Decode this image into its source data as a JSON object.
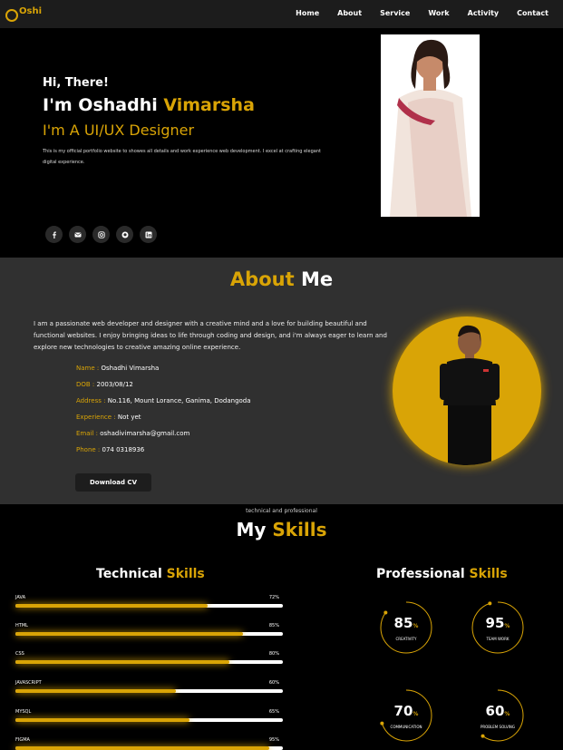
{
  "nav": {
    "logo": "Oshi",
    "items": [
      "Home",
      "About",
      "Service",
      "Work",
      "Activity",
      "Contact"
    ]
  },
  "hero": {
    "greeting": "Hi, There!",
    "name_prefix": "I'm Oshadhi",
    "name_highlight": "Vimarsha",
    "role": "I'm A UI/UX Designer",
    "description": "This is my official portfolio website to showes all details and work experience web development. I excel at crafting elegant digital experience.",
    "socials": [
      "facebook-icon",
      "mail-icon",
      "instagram-icon",
      "github-icon",
      "linkedin-icon"
    ]
  },
  "about": {
    "title_highlight": "About",
    "title_rest": "Me",
    "paragraph": "I am a passionate web developer and designer with a creative mind and a love for building beautiful and functional websites. I enjoy bringing ideas to life through coding and design, and i'm always eager to learn and explore new technologies to creative amazing online experience.",
    "info": [
      {
        "key": "Name",
        "value": "Oshadhi Vimarsha"
      },
      {
        "key": "DOB",
        "value": "2003/08/12"
      },
      {
        "key": "Address",
        "value": "No.116, Mount Lorance, Ganima, Dodangoda"
      },
      {
        "key": "Experience",
        "value": "Not yet"
      },
      {
        "key": "Email",
        "value": "oshadivimarsha@gmail.com"
      },
      {
        "key": "Phone",
        "value": "074 0318936"
      }
    ],
    "download": "Download CV"
  },
  "skills": {
    "subtitle": "technical and professional",
    "title_rest": "My",
    "title_highlight": "Skills",
    "tech_title": "Technical",
    "tech_highlight": "Skills",
    "prof_title": "Professional",
    "prof_highlight": "Skills",
    "technical": [
      {
        "name": "JAVA",
        "pct": "72%",
        "value": 72
      },
      {
        "name": "HTML",
        "pct": "85%",
        "value": 85
      },
      {
        "name": "CSS",
        "pct": "80%",
        "value": 80
      },
      {
        "name": "JAVASCRIPT",
        "pct": "60%",
        "value": 60
      },
      {
        "name": "MYSQL",
        "pct": "65%",
        "value": 65
      },
      {
        "name": "FIGMA",
        "pct": "95%",
        "value": 95
      }
    ],
    "professional": [
      {
        "value": "85",
        "label": "CREATIVITY",
        "level": 85
      },
      {
        "value": "95",
        "label": "TEAM WORK",
        "level": 95
      },
      {
        "value": "70",
        "label": "COMMUNICATION",
        "level": 70
      },
      {
        "value": "60",
        "label": "PROBLEM SOLVING",
        "level": 60
      }
    ],
    "percent_sign": "%"
  },
  "colors": {
    "accent": "#d9a406",
    "bg": "#000000",
    "section": "#303030"
  }
}
